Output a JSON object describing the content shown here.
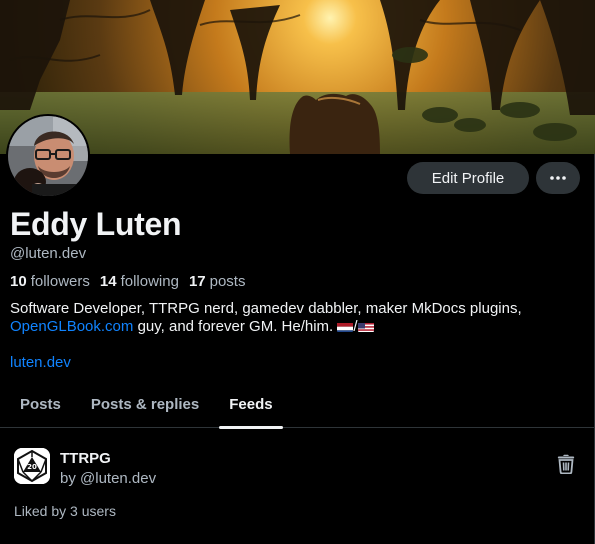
{
  "profile": {
    "display_name": "Eddy Luten",
    "handle": "@luten.dev",
    "followers_count": "10",
    "followers_label": "followers",
    "following_count": "14",
    "following_label": "following",
    "posts_count": "17",
    "posts_label": "posts",
    "bio_part1": "Software Developer, TTRPG nerd, gamedev dabbler, maker MkDocs plugins, ",
    "bio_link": "OpenGLBook.com",
    "bio_part2": " guy, and forever GM. He/him. ",
    "bio_separator": "/",
    "website": "luten.dev"
  },
  "actions": {
    "edit_label": "Edit Profile",
    "more_icon": "ellipsis-icon"
  },
  "tabs": [
    {
      "label": "Posts",
      "active": false
    },
    {
      "label": "Posts & replies",
      "active": false
    },
    {
      "label": "Feeds",
      "active": true
    }
  ],
  "feed": {
    "title": "TTRPG",
    "by": "by @luten.dev",
    "likes": "Liked by 3 users",
    "delete_icon": "trash-icon",
    "feed_icon": "d20-dice-icon"
  },
  "colors": {
    "background": "#000000",
    "text": "#f1f3f5",
    "muted": "#aeb8c2",
    "link": "#1083fe",
    "button": "#2e3438"
  }
}
